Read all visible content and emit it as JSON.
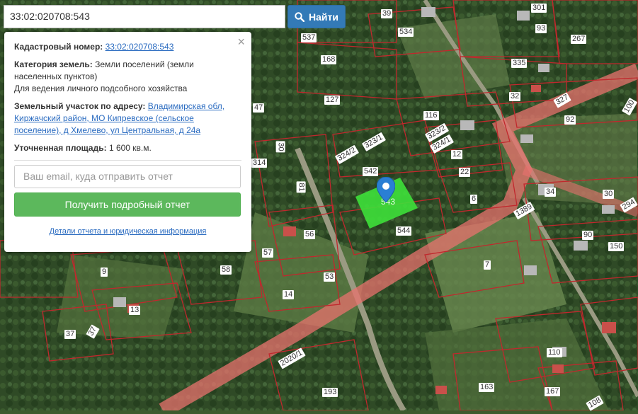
{
  "search": {
    "value": "33:02:020708:543",
    "button_label": "Найти"
  },
  "popup": {
    "cadastral_label": "Кадастровый номер:",
    "cadastral_value": "33:02:020708:543",
    "category_label": "Категория земель:",
    "category_value": "Земли поселений (земли населенных пунктов)",
    "usage": "Для ведения личного подсобного хозяйства",
    "address_label": "Земельный участок по адресу:",
    "address_value": "Владимирская обл, Киржачский район, МО Кипревское (сельское поселение), д Хмелево, ул Центральная, д 24а",
    "area_label": "Уточненная площадь:",
    "area_value": "1 600 кв.м.",
    "email_placeholder": "Ваш email, куда отправить отчет",
    "report_button": "Получить подробный отчет",
    "details_link": "Детали отчета и юридическая информация",
    "close_symbol": "×"
  },
  "map": {
    "selected_plot_label": "543",
    "plot_labels": [
      "39",
      "301",
      "93",
      "537",
      "534",
      "267",
      "168",
      "335",
      "127",
      "32",
      "327",
      "100",
      "47",
      "116",
      "92",
      "323/2",
      "30",
      "323/1",
      "324/1",
      "324/2",
      "12",
      "314",
      "542",
      "22",
      "81",
      "34",
      "30",
      "294",
      "6",
      "1389",
      "544",
      "56",
      "90",
      "150",
      "57",
      "58",
      "7",
      "9",
      "53",
      "14",
      "13",
      "2020/1",
      "37",
      "37",
      "110",
      "193",
      "163",
      "167",
      "108"
    ]
  },
  "colors": {
    "parcel_border": "#c0282d",
    "selected_fill": "#3ee03a",
    "road": "#e8726e",
    "button_blue": "#337ab7",
    "button_green": "#5cb85c"
  }
}
